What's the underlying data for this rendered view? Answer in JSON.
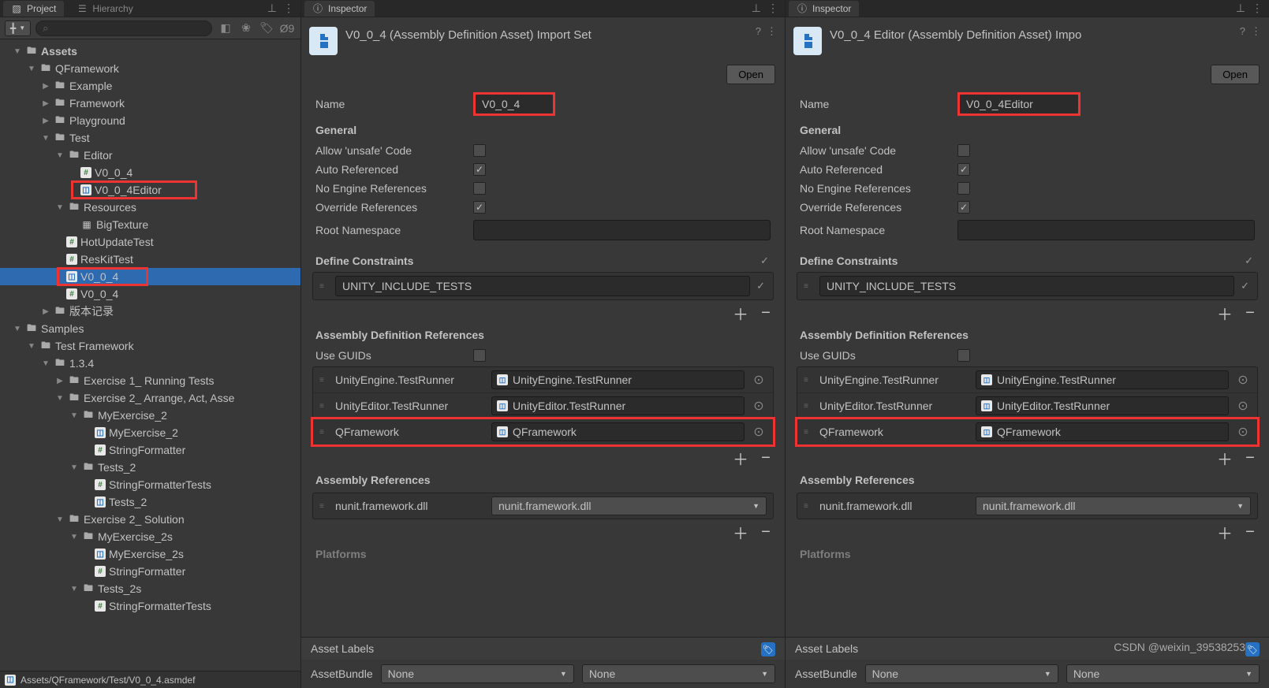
{
  "project": {
    "tab": "Project",
    "hierarchy_tab": "Hierarchy",
    "visibility_count": "9",
    "tree": {
      "assets": "Assets",
      "qframework": "QFramework",
      "example": "Example",
      "framework": "Framework",
      "playground": "Playground",
      "test": "Test",
      "editor": "Editor",
      "v0_0_4": "V0_0_4",
      "v0_0_4_editor": "V0_0_4Editor",
      "resources": "Resources",
      "bigtexture": "BigTexture",
      "hotupdatetest": "HotUpdateTest",
      "reskittest": "ResKitTest",
      "v0_0_4_sel": "V0_0_4",
      "v0_0_4_cs": "V0_0_4",
      "version_history": "版本记录",
      "samples": "Samples",
      "test_framework": "Test Framework",
      "ver_134": "1.3.4",
      "ex1": "Exercise 1_ Running Tests",
      "ex2": "Exercise 2_ Arrange, Act, Asse",
      "myex2": "MyExercise_2",
      "myex2_file": "MyExercise_2",
      "stringformatter": "StringFormatter",
      "tests2": "Tests_2",
      "stringformattertests": "StringFormatterTests",
      "tests2_file": "Tests_2",
      "ex2sol": "Exercise 2_ Solution",
      "myex2s": "MyExercise_2s",
      "myex2s_file": "MyExercise_2s",
      "stringformatter2": "StringFormatter",
      "tests2s": "Tests_2s",
      "stringformattertests2": "StringFormatterTests"
    },
    "status": "Assets/QFramework/Test/V0_0_4.asmdef"
  },
  "inspector1": {
    "tab": "Inspector",
    "title": "V0_0_4 (Assembly Definition Asset) Import Set",
    "open_btn": "Open",
    "name_label": "Name",
    "name_value": "V0_0_4",
    "general": "General",
    "allow_unsafe": "Allow 'unsafe' Code",
    "auto_ref": "Auto Referenced",
    "no_engine": "No Engine References",
    "override_ref": "Override References",
    "root_ns": "Root Namespace",
    "define_constraints": "Define Constraints",
    "unity_tests": "UNITY_INCLUDE_TESTS",
    "asm_def_refs": "Assembly Definition References",
    "use_guids": "Use GUIDs",
    "ref1_label": "UnityEngine.TestRunner",
    "ref1_value": "UnityEngine.TestRunner",
    "ref2_label": "UnityEditor.TestRunner",
    "ref2_value": "UnityEditor.TestRunner",
    "ref3_label": "QFramework",
    "ref3_value": "QFramework",
    "asm_refs": "Assembly References",
    "nunit_label": "nunit.framework.dll",
    "nunit_value": "nunit.framework.dll",
    "platforms": "Platforms",
    "asset_labels": "Asset Labels",
    "assetbundle": "AssetBundle",
    "none": "None"
  },
  "inspector2": {
    "tab": "Inspector",
    "title": "V0_0_4 Editor (Assembly Definition Asset) Impo",
    "open_btn": "Open",
    "name_label": "Name",
    "name_value": "V0_0_4Editor",
    "general": "General",
    "allow_unsafe": "Allow 'unsafe' Code",
    "auto_ref": "Auto Referenced",
    "no_engine": "No Engine References",
    "override_ref": "Override References",
    "root_ns": "Root Namespace",
    "define_constraints": "Define Constraints",
    "unity_tests": "UNITY_INCLUDE_TESTS",
    "asm_def_refs": "Assembly Definition References",
    "use_guids": "Use GUIDs",
    "ref1_label": "UnityEngine.TestRunner",
    "ref1_value": "UnityEngine.TestRunner",
    "ref2_label": "UnityEditor.TestRunner",
    "ref2_value": "UnityEditor.TestRunner",
    "ref3_label": "QFramework",
    "ref3_value": "QFramework",
    "asm_refs": "Assembly References",
    "nunit_label": "nunit.framework.dll",
    "nunit_value": "nunit.framework.dll",
    "platforms": "Platforms",
    "asset_labels": "Asset Labels",
    "assetbundle": "AssetBundle",
    "none": "None"
  },
  "watermark": "CSDN @weixin_39538253"
}
